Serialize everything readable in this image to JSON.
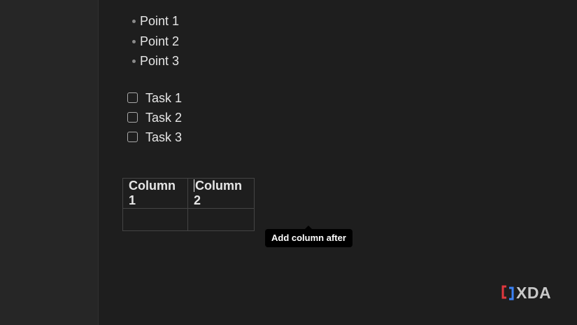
{
  "bullets": [
    "Point 1",
    "Point 2",
    "Point 3"
  ],
  "tasks": [
    {
      "label": "Task 1",
      "checked": false
    },
    {
      "label": "Task 2",
      "checked": false
    },
    {
      "label": "Task 3",
      "checked": false
    }
  ],
  "table": {
    "headers": [
      "Column 1",
      "Column 2"
    ],
    "rows": [
      [
        "",
        ""
      ]
    ]
  },
  "tooltip": "Add column after",
  "watermark": {
    "text": "XDA",
    "accent_color": "#e0383e",
    "secondary_color": "#3b82f6"
  },
  "colors": {
    "background": "#1e1e1e",
    "sidebar": "#262626",
    "text": "#e6e6e6"
  }
}
